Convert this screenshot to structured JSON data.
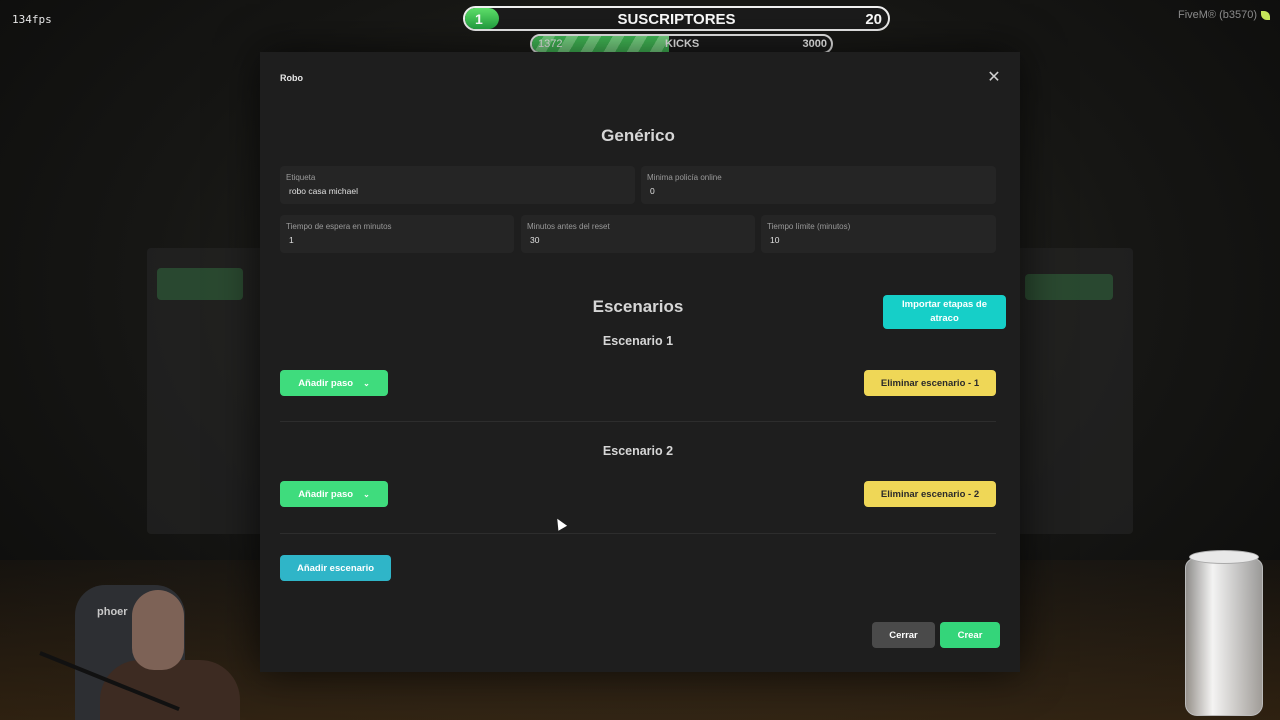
{
  "overlay": {
    "fps": "134fps",
    "fivem_label": "FiveM® (b3570)"
  },
  "subscribers": {
    "level": "1",
    "title": "SUSCRIPTORES",
    "goal": "20",
    "progress": 0.05
  },
  "kicks": {
    "current": "1372",
    "title": "KICKS",
    "goal": "3000",
    "progress": 0.4573
  },
  "modal": {
    "title": "Robo",
    "generic_heading": "Genérico",
    "fields": {
      "etiqueta": {
        "label": "Etiqueta",
        "value": "robo casa michael"
      },
      "min_policia": {
        "label": "Minima policía online",
        "value": "0"
      },
      "espera": {
        "label": "Tiempo de espera en minutos",
        "value": "1"
      },
      "reset": {
        "label": "Minutos antes del reset",
        "value": "30"
      },
      "limite": {
        "label": "Tiempo límite (minutos)",
        "value": "10"
      }
    },
    "escenarios_heading": "Escenarios",
    "import_button": "Importar etapas de atraco",
    "scenarios": [
      {
        "title": "Escenario 1",
        "add_step": "Añadir paso",
        "delete": "Eliminar escenario - 1"
      },
      {
        "title": "Escenario 2",
        "add_step": "Añadir paso",
        "delete": "Eliminar escenario - 2"
      }
    ],
    "add_scenario": "Añadir escenario",
    "close_button": "Cerrar",
    "create_button": "Crear"
  },
  "webcam": {
    "chair_text": "phoer"
  },
  "colors": {
    "green": "#3fdc7d",
    "yellow": "#efd757",
    "teal": "#16cfc8",
    "cyan": "#2fb5c8"
  }
}
